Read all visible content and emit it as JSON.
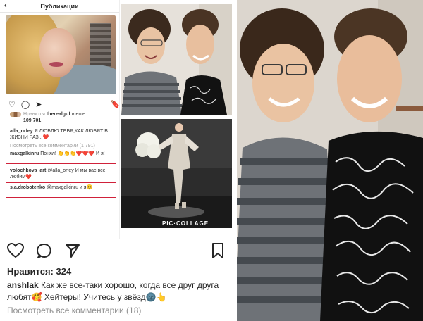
{
  "left_post": {
    "header_title": "Публикации",
    "back_glyph": "‹",
    "likes_text": "Нравится",
    "likes_user": "therealguf",
    "likes_more": "и еще",
    "likes_count": "109 701",
    "comments": [
      {
        "user": "alla_orfey",
        "text": "Я ЛЮБЛЮ ТЕБЯ,КАК ЛЮБЯТ В ЖИЗНИ РАЗ...❤️"
      },
      {
        "user": "",
        "text": "Посмотреть все комментарии (1 791)"
      },
      {
        "user": "maxgalkinru",
        "text": "Понял! 👏👏👏❤️❤️❤️ И я!"
      },
      {
        "user": "volochkova_art",
        "text": "@alla_orfey И мы вас все любим❤️"
      },
      {
        "user": "s.a.drobotenko",
        "text": "@maxgalkinru и я😊"
      }
    ]
  },
  "collage_label": "PIC·COLLAGE",
  "bottom_post": {
    "likes": "Нравится: 324",
    "caption_user": "anshlak",
    "caption_text": "Как же все-таки хорошо, когда все друг друга любят🥰 Хейтеры! Учитесь у звёзд🌚👆",
    "view_all": "Посмотреть все комментарии (18)"
  },
  "colors": {
    "highlight": "#d0213a",
    "muted": "#8e8e8e",
    "text": "#262626"
  }
}
